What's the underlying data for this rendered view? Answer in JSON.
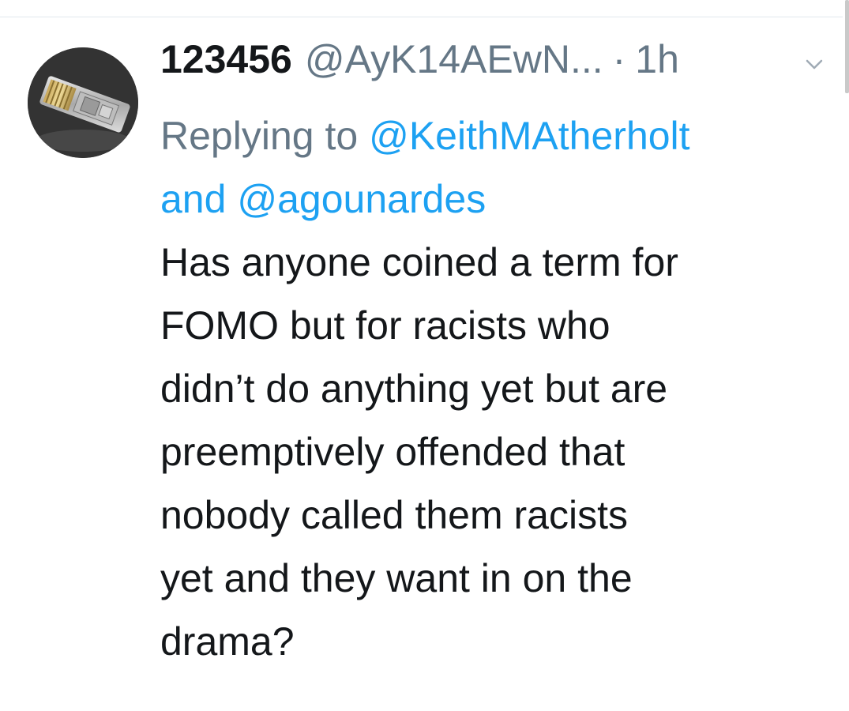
{
  "tweet": {
    "display_name": "123456",
    "handle": "@AyK14AEwN...",
    "separator": "·",
    "time": "1h",
    "replying_prefix": "Replying to",
    "reply_to_1": "@KeithMAtherholt",
    "reply_and": "and",
    "reply_to_2": "@agounardes",
    "text_lines": [
      "Has anyone coined a term for",
      "FOMO but for racists who",
      "didn’t do anything yet but are",
      "preemptively offended that",
      "nobody called them racists",
      "yet and they want in on the",
      "drama?"
    ]
  },
  "icons": {
    "avatar": "avatar-image",
    "more": "chevron-down-icon"
  },
  "colors": {
    "text": "#14171a",
    "secondary": "#657786",
    "link": "#1da1f2",
    "divider": "#e1e8ed"
  }
}
